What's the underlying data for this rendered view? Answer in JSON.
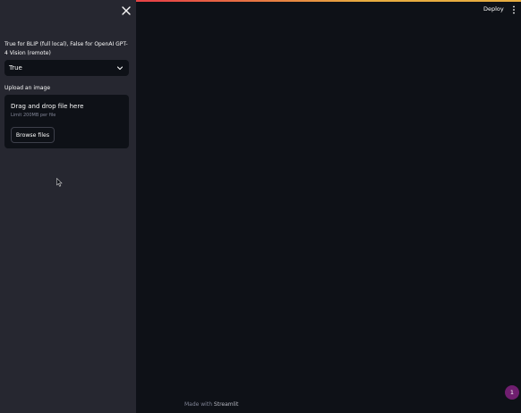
{
  "sidebar": {
    "select_label": "True for BLIP (full local), False for OpenAI GPT-4 Vision (remote)",
    "select_value": "True",
    "upload_label": "Upload an image",
    "dropzone": {
      "title": "Drag and drop file here",
      "limit": "Limit 200MB per file",
      "browse_label": "Browse files"
    }
  },
  "header": {
    "deploy_label": "Deploy"
  },
  "footer": {
    "made_with": "Made with",
    "brand": "Streamlit"
  },
  "badge": {
    "count": "1",
    "color": "#6f1e6f"
  },
  "colors": {
    "sidebar_bg": "#262730",
    "main_bg": "#0e1117",
    "text": "#fafafa",
    "muted": "#808495"
  },
  "icons": {
    "close": "close-icon",
    "chevron": "chevron-down-icon",
    "menu": "kebab-menu-icon",
    "cursor": "mouse-cursor-icon"
  }
}
